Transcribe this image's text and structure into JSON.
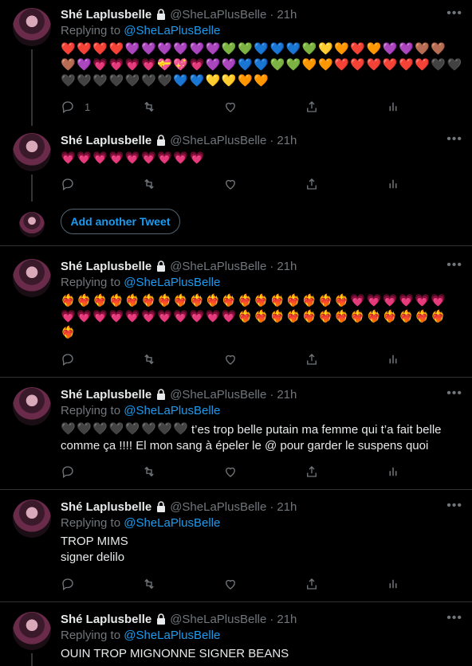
{
  "author": {
    "name": "Shé Laplusbelle",
    "handle": "@SheLaPlusBelle",
    "time": "21h",
    "dot": "·"
  },
  "replying": {
    "prefix": "Replying to ",
    "to": "@SheLaPlusBelle"
  },
  "more_label": "•••",
  "add_tweet_label": "Add another Tweet",
  "tweet1": {
    "reply_count": "1",
    "emoji_rows": [
      [
        "❤️",
        "❤️",
        "❤️",
        "❤️",
        "💜",
        "💜",
        "💜",
        "💜",
        "💜",
        "💜",
        "💚",
        "💚",
        "💙",
        "💙",
        "💙",
        "💚",
        "💛",
        "🧡",
        "❤️",
        "🧡",
        "💜",
        "💜",
        "🤎",
        "🤎"
      ],
      [
        "🤎",
        "💜",
        "💗",
        "💗",
        "💗",
        "💗",
        "💝",
        "💖",
        "💗",
        "💜",
        "💜",
        "💙",
        "💙",
        "💚",
        "💚",
        "🧡",
        "🧡",
        "❤️",
        "❤️",
        "❤️",
        "❤️",
        "❤️",
        "❤️",
        "🖤",
        "🖤"
      ],
      [
        "🖤",
        "🖤",
        "🖤",
        "🖤",
        "🖤",
        "🖤",
        "🖤",
        "💙",
        "💙",
        "💛",
        "💛",
        "🧡",
        "🧡"
      ]
    ]
  },
  "tweet2": {
    "emoji_rows": [
      [
        "💗",
        "💗",
        "💗",
        "💗",
        "💗",
        "💗",
        "💗",
        "💗",
        "💗"
      ]
    ]
  },
  "tweet3": {
    "emoji_rows": [
      [
        "❤️‍🔥",
        "❤️‍🔥",
        "❤️‍🔥",
        "❤️‍🔥",
        "❤️‍🔥",
        "❤️‍🔥",
        "❤️‍🔥",
        "❤️‍🔥",
        "❤️‍🔥",
        "❤️‍🔥",
        "❤️‍🔥",
        "❤️‍🔥",
        "❤️‍🔥",
        "❤️‍🔥",
        "❤️‍🔥",
        "❤️‍🔥",
        "❤️‍🔥",
        "❤️‍🔥",
        "💗",
        "💗",
        "💗",
        "💗",
        "💗",
        "💗"
      ],
      [
        "💗",
        "💗",
        "💗",
        "💗",
        "💗",
        "💗",
        "💗",
        "💗",
        "💗",
        "💗",
        "💗",
        "❤️‍🔥",
        "❤️‍🔥",
        "❤️‍🔥",
        "❤️‍🔥",
        "❤️‍🔥",
        "❤️‍🔥",
        "❤️‍🔥",
        "❤️‍🔥",
        "❤️‍🔥",
        "❤️‍🔥",
        "❤️‍🔥",
        "❤️‍🔥",
        "❤️‍🔥"
      ],
      [
        "❤️‍🔥"
      ]
    ]
  },
  "tweet4": {
    "emoji_rows": [
      [
        "🖤",
        "🖤",
        "🖤",
        "🖤",
        "🖤",
        "🖤",
        "🖤",
        "🖤"
      ]
    ],
    "text_inline": "t’es trop belle putain ma femme qui t’a fait belle",
    "text_line2": "comme ça !!!! El mon sang à épeler le @ pour garder le suspens quoi"
  },
  "tweet5": {
    "line1": "TROP MIMS",
    "line2": "signer delilo"
  },
  "tweet6": {
    "line1": "OUIN TROP MIGNONNE SIGNER BEANS"
  },
  "icons": [
    "reply-icon",
    "retweet-icon",
    "like-icon",
    "share-icon",
    "analytics-icon",
    "lock-icon",
    "more-icon"
  ]
}
